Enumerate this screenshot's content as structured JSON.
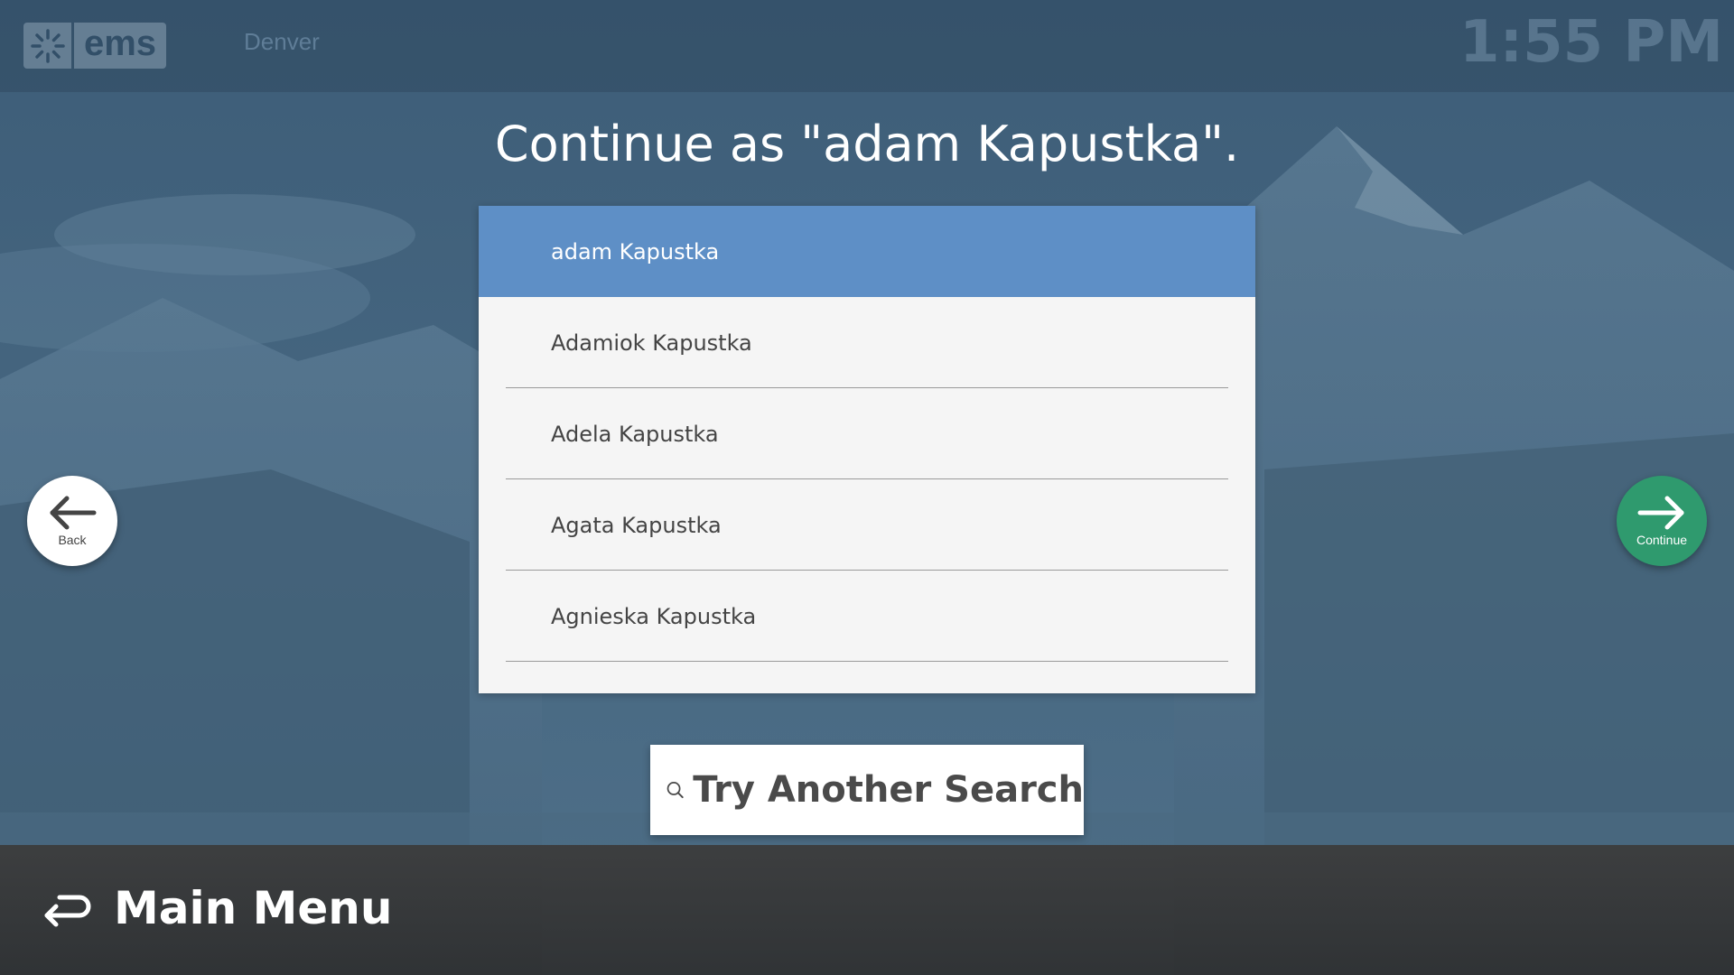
{
  "header": {
    "logo_text": "ems",
    "location": "Denver",
    "time": "1:55 PM"
  },
  "page": {
    "title": "Continue as \"adam Kapustka\"."
  },
  "results": {
    "items": [
      {
        "name": "adam Kapustka",
        "selected": true
      },
      {
        "name": "Adamiok Kapustka",
        "selected": false
      },
      {
        "name": "Adela Kapustka",
        "selected": false
      },
      {
        "name": "Agata Kapustka",
        "selected": false
      },
      {
        "name": "Agnieska Kapustka",
        "selected": false
      }
    ]
  },
  "navigation": {
    "back_label": "Back",
    "continue_label": "Continue",
    "back_icon": "arrow-left-icon",
    "continue_icon": "arrow-right-icon"
  },
  "search": {
    "label": "Try Another Search",
    "icon": "search-icon"
  },
  "footer": {
    "main_menu_label": "Main Menu",
    "icon": "return-icon"
  },
  "colors": {
    "selected_row": "#5e8fc6",
    "continue_button": "#2f9a6e",
    "list_background": "#f5f5f5",
    "footer_background": "#3c3c3c"
  }
}
